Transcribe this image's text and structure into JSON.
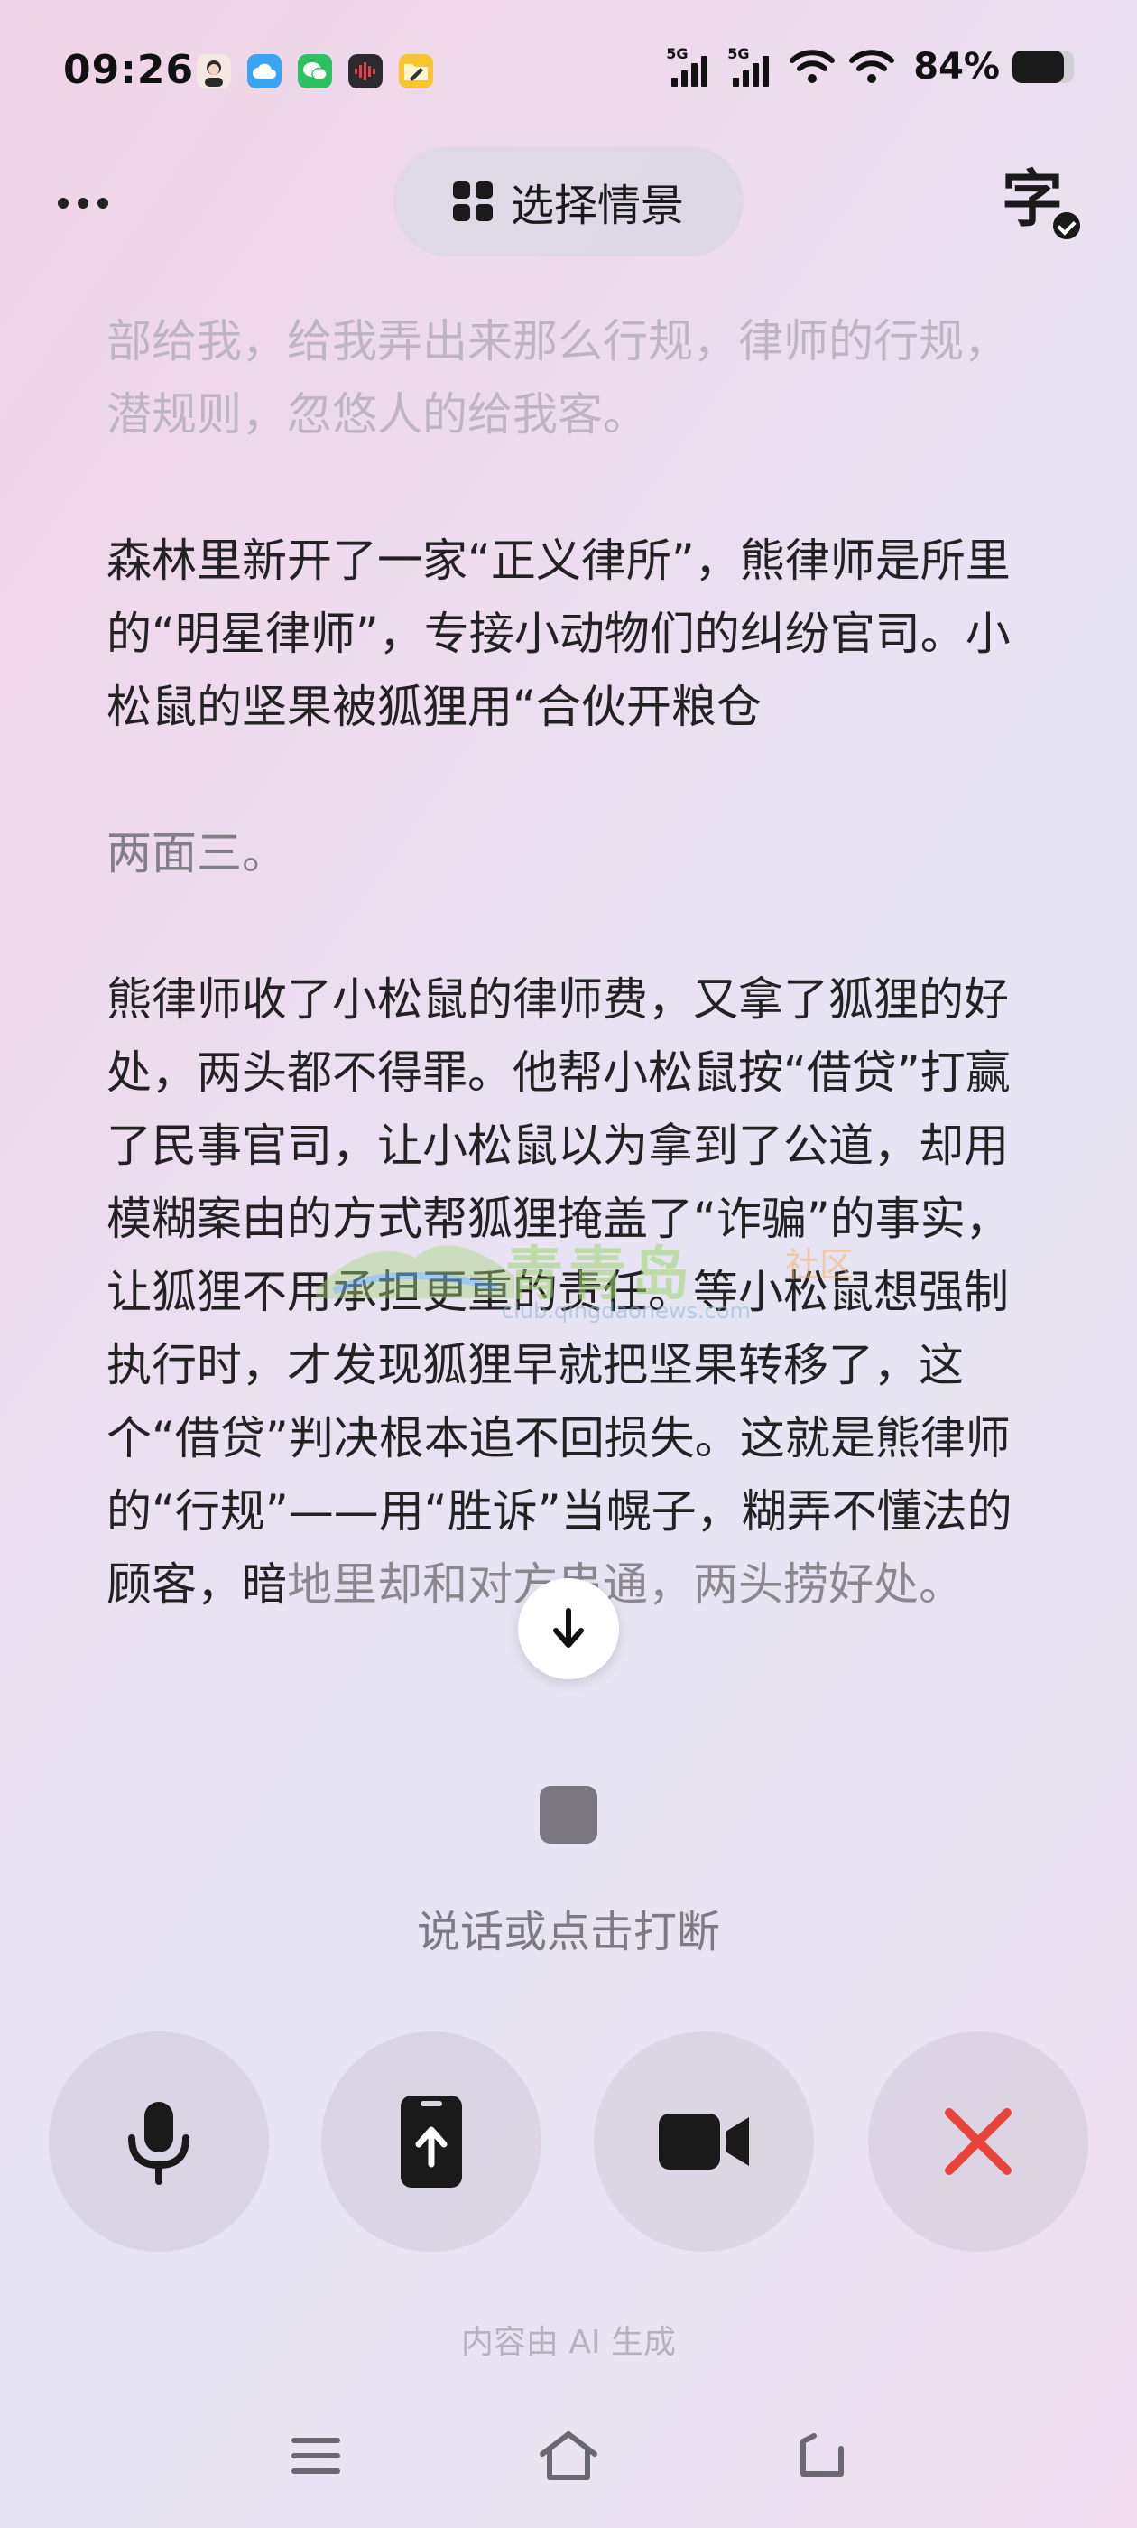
{
  "status_bar": {
    "time": "09:26",
    "notification_icons": [
      "avatar-icon",
      "cloud-icon",
      "wechat-icon",
      "voice-recorder-icon",
      "folder-icon"
    ],
    "signal_1_label": "5G",
    "signal_2_label": "5G",
    "battery_text": "84%",
    "battery_level": 0.84
  },
  "header": {
    "scene_button_label": "选择情景",
    "caption_toggle_char": "字"
  },
  "transcript": {
    "paragraphs": [
      "部给我，给我弄出来那么行规，律师的行规，潜规则，忽悠人的给我客。",
      "森林里新开了一家“正义律所”，熊律师是所里的“明星律师”，专接小动物们的纠纷官司。小松鼠的坚果被狐狸用“合伙开粮仓",
      "两面三。",
      "熊律师收了小松鼠的律师费，又拿了狐狸的好处，两头都不得罪。他帮小松鼠按“借贷”打赢了民事官司，让小松鼠以为拿到了公道，却用模糊案由的方式帮狐狸掩盖了“诈骗”的事实，让狐狸不用承担更重的责任。等小松鼠想强制执行时，才发现狐狸早就把坚果转移了，这个“借贷”判决根本追不回损失。这就是熊律师的“行规”——用“胜诉”当幌子，糊弄不懂法的顾客，暗"
    ],
    "last_line_tail": "地里却和对方串通，两头捞好处。"
  },
  "watermark": {
    "brand": "青青岛",
    "suffix": "社区",
    "url": "club.qingdaonews.com"
  },
  "interrupt_hint": "说话或点击打断",
  "controls": {
    "icons": [
      "microphone-icon",
      "share-screen-icon",
      "video-camera-icon",
      "close-icon"
    ],
    "close_color": "#e8433a"
  },
  "footer_note": "内容由 AI 生成",
  "nav": [
    "menu-icon",
    "home-icon",
    "back-icon"
  ]
}
